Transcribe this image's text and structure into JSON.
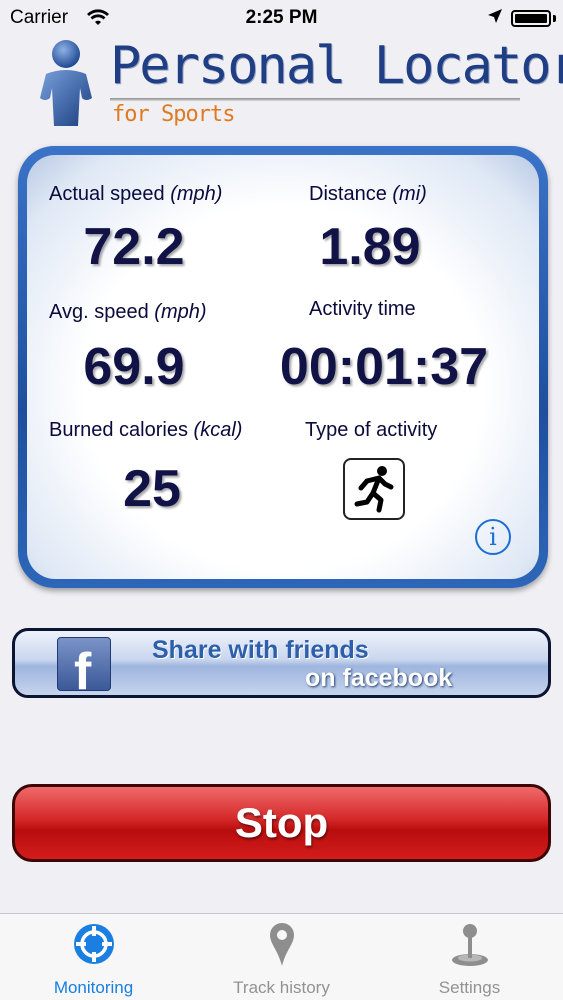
{
  "status_bar": {
    "carrier": "Carrier",
    "time": "2:25 PM"
  },
  "header": {
    "title": "Personal Locator",
    "subtitle": "for Sports"
  },
  "stats": {
    "actual_speed": {
      "label": "Actual speed",
      "unit": "(mph)",
      "value": "72.2"
    },
    "distance": {
      "label": "Distance",
      "unit": "(mi)",
      "value": "1.89"
    },
    "avg_speed": {
      "label": "Avg. speed",
      "unit": "(mph)",
      "value": "69.9"
    },
    "activity_time": {
      "label": "Activity time",
      "value": "00:01:37"
    },
    "burned_calories": {
      "label": "Burned calories",
      "unit": "(kcal)",
      "value": "25"
    },
    "activity_type": {
      "label": "Type of activity",
      "icon": "running-person-icon"
    },
    "info_symbol": "i"
  },
  "facebook_button": {
    "line1": "Share with friends",
    "line2": "on facebook",
    "logo_letter": "f"
  },
  "stop_button": {
    "label": "Stop"
  },
  "tabs": [
    {
      "label": "Monitoring",
      "icon": "crosshair-icon",
      "active": true
    },
    {
      "label": "Track history",
      "icon": "map-pin-icon",
      "active": false
    },
    {
      "label": "Settings",
      "icon": "joystick-icon",
      "active": false
    }
  ],
  "colors": {
    "accent": "#1a7fe0",
    "panel_border": "#2a5fb0",
    "stop_red": "#d42828",
    "title_blue": "#1f3e84",
    "subtitle_orange": "#e07a1f"
  }
}
